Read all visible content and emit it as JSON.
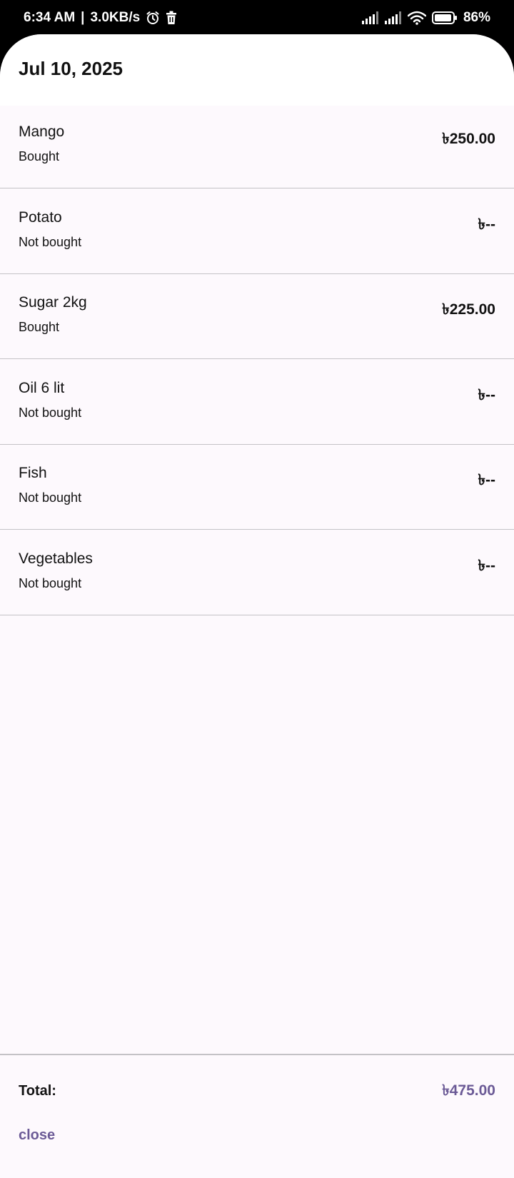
{
  "status_bar": {
    "time": "6:34 AM",
    "separator": "|",
    "network_speed": "3.0KB/s",
    "battery_percent": "86%",
    "icons": [
      "alarm-icon",
      "trash-icon",
      "signal-icon",
      "signal-icon",
      "wifi-icon",
      "battery-icon"
    ]
  },
  "sheet": {
    "title": "Jul 10, 2025"
  },
  "items": [
    {
      "name": "Mango",
      "status": "Bought",
      "price": "৳250.00"
    },
    {
      "name": "Potato",
      "status": "Not bought",
      "price": "৳--"
    },
    {
      "name": "Sugar 2kg",
      "status": "Bought",
      "price": "৳225.00"
    },
    {
      "name": "Oil 6 lit",
      "status": "Not bought",
      "price": "৳--"
    },
    {
      "name": "Fish",
      "status": "Not bought",
      "price": "৳--"
    },
    {
      "name": "Vegetables",
      "status": "Not bought",
      "price": "৳--"
    }
  ],
  "footer": {
    "total_label": "Total:",
    "total_value": "৳475.00",
    "close_label": "close"
  },
  "colors": {
    "accent": "#6b5a96",
    "sheet_background": "#fdf9fd",
    "divider": "#c4c2c6"
  }
}
